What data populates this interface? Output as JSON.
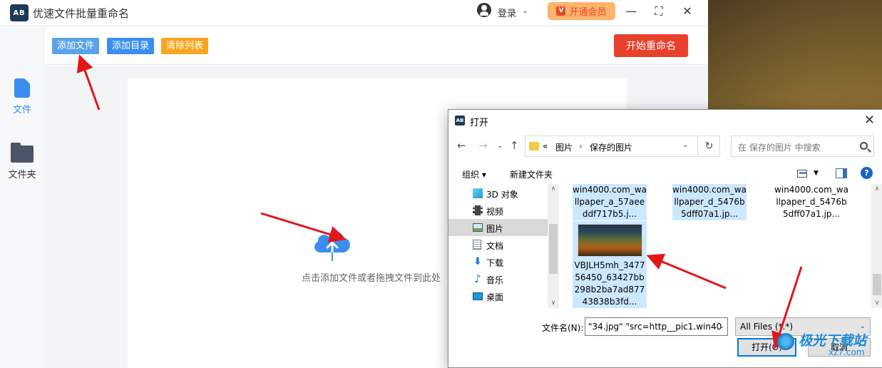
{
  "app": {
    "logo_text": "AB",
    "title": "优速文件批量重命名",
    "login_label": "登录",
    "login_caret": "⌄",
    "vip_label": "开通会员",
    "win_minimize": "—",
    "win_maximize": "⛶",
    "win_close": "✕"
  },
  "sidebar": {
    "items": [
      {
        "label": "文件",
        "icon": "file-icon",
        "color": "#3b8ef0"
      },
      {
        "label": "文件夹",
        "icon": "folder-icon",
        "color": "#4a5568"
      }
    ]
  },
  "toolbar": {
    "add_file": "添加文件",
    "add_folder": "添加目录",
    "clear_list": "清除列表",
    "start_rename": "开始重命名",
    "colors": {
      "add_file": "#5ba3e8",
      "add_folder": "#3b8ef0",
      "clear_list": "#f7a520",
      "start_rename": "#e8402c"
    }
  },
  "dropzone": {
    "hint": "点击添加文件或者拖拽文件到此处",
    "icon": "cloud-upload-icon"
  },
  "dialog": {
    "title": "打开",
    "close": "✕",
    "breadcrumb": {
      "prefix": "«",
      "crumbs": [
        "图片",
        "保存的图片"
      ],
      "separator": "›"
    },
    "search_placeholder": "在 保存的图片 中搜索",
    "commands": {
      "organize": "组织 ▾",
      "new_folder": "新建文件夹",
      "help": "?"
    },
    "tree": [
      {
        "label": "3D 对象",
        "icon": "3d-objects-icon",
        "selected": false
      },
      {
        "label": "视频",
        "icon": "video-icon",
        "selected": false
      },
      {
        "label": "图片",
        "icon": "pictures-icon",
        "selected": true
      },
      {
        "label": "文档",
        "icon": "documents-icon",
        "selected": false
      },
      {
        "label": "下载",
        "icon": "download-icon",
        "selected": false
      },
      {
        "label": "音乐",
        "icon": "music-icon",
        "selected": false
      },
      {
        "label": "桌面",
        "icon": "desktop-icon",
        "selected": false
      }
    ],
    "files": [
      {
        "name": "win4000.com_wallpaper_a_57aeeddf717b5.j...",
        "selected": true
      },
      {
        "name": "win4000.com_wallpaper_d_5476b5dff07a1.jp...",
        "selected": true
      },
      {
        "name": "win4000.com_wallpaper_d_5476b5dff07a1.jp...",
        "selected": false
      },
      {
        "name": "VBJLH5mh_347756450_63427bb298b2ba7ad87743838b3fd...",
        "selected": true
      }
    ],
    "filename_label": "文件名(N):",
    "filename_value": "\"34.jpg\" \"src=http__pic1.win40",
    "filter_value": "All Files (*.*)",
    "open_button": "打开(O)",
    "cancel_button": "取消"
  },
  "watermark": {
    "text": "极光下载站",
    "sub": "xz7.com"
  }
}
